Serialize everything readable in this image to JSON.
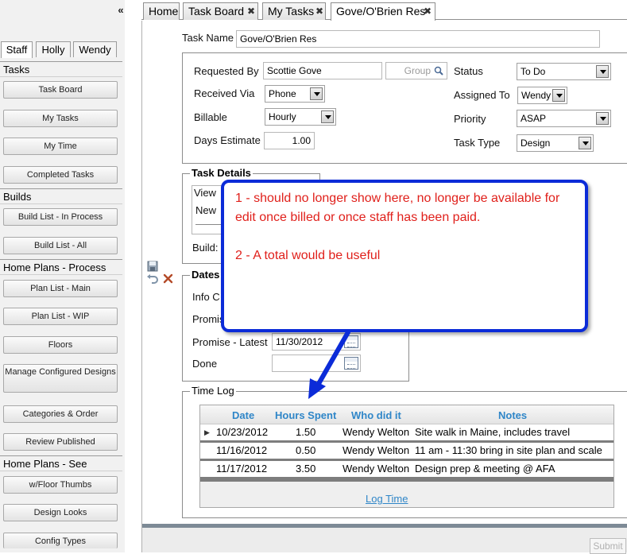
{
  "sidebar": {
    "collapse_glyph": "«",
    "staff_tabs": [
      "Staff",
      "Holly",
      "Wendy"
    ],
    "sections": {
      "tasks": {
        "title": "Tasks",
        "items": [
          "Task Board",
          "My Tasks",
          "My Time",
          "Completed Tasks"
        ]
      },
      "builds": {
        "title": "Builds",
        "items": [
          "Build List - In Process",
          "Build List - All"
        ]
      },
      "home_plans_process": {
        "title": "Home Plans - Process",
        "items": [
          "Plan List - Main",
          "Plan List - WIP",
          "Floors",
          "Manage Configured Designs",
          "Categories & Order",
          "Review Published"
        ]
      },
      "home_plans_see": {
        "title": "Home Plans - See",
        "items": [
          "w/Floor Thumbs",
          "Design Looks",
          "Config Types"
        ]
      }
    }
  },
  "tabs": {
    "home": "Home",
    "task_board": "Task Board",
    "my_tasks": "My Tasks",
    "gove": "Gove/O'Brien Res",
    "close_glyph": "✖"
  },
  "form": {
    "task_name_label": "Task Name",
    "task_name_value": "Gove/O'Brien Res",
    "requested_by_label": "Requested By",
    "requested_by_value": "Scottie Gove",
    "group_placeholder": "Group",
    "received_via_label": "Received Via",
    "received_via_value": "Phone",
    "billable_label": "Billable",
    "billable_value": "Hourly",
    "days_estimate_label": "Days Estimate",
    "days_estimate_value": "1.00",
    "status_label": "Status",
    "status_value": "To Do",
    "assigned_to_label": "Assigned To",
    "assigned_to_value": "Wendy",
    "priority_label": "Priority",
    "priority_value": "ASAP",
    "task_type_label": "Task Type",
    "task_type_value": "Design"
  },
  "task_details": {
    "legend": "Task Details",
    "view_text": "View",
    "new_text": "New",
    "build_label": "Build:"
  },
  "dates": {
    "legend": "Dates",
    "info_label": "Info C",
    "promise_label": "Promis",
    "promise_latest_label": "Promise - Latest",
    "promise_latest_value": "11/30/2012",
    "done_label": "Done",
    "done_value": ""
  },
  "time_log": {
    "legend": "Time Log",
    "columns": [
      "Date",
      "Hours Spent",
      "Who did it",
      "Notes"
    ],
    "rows": [
      {
        "date": "10/23/2012",
        "hours": "1.50",
        "who": "Wendy Welton",
        "notes": "Site walk in Maine, includes travel"
      },
      {
        "date": "11/16/2012",
        "hours": "0.50",
        "who": "Wendy Welton",
        "notes": "11 am - 11:30 bring in site plan and scale"
      },
      {
        "date": "11/17/2012",
        "hours": "3.50",
        "who": "Wendy Welton",
        "notes": "Design prep & meeting @ AFA"
      }
    ],
    "row_marker": "▶",
    "log_time_link": "Log Time"
  },
  "submit_label": "Submit",
  "callout": {
    "line1": "1 - should no longer show here, no longer be available for edit once billed or once staff has been paid.",
    "line2": "2 - A total would be useful"
  },
  "colors": {
    "callout_border": "#0b2bd8",
    "callout_text": "#e0201b",
    "grid_header": "#2f86c8"
  }
}
